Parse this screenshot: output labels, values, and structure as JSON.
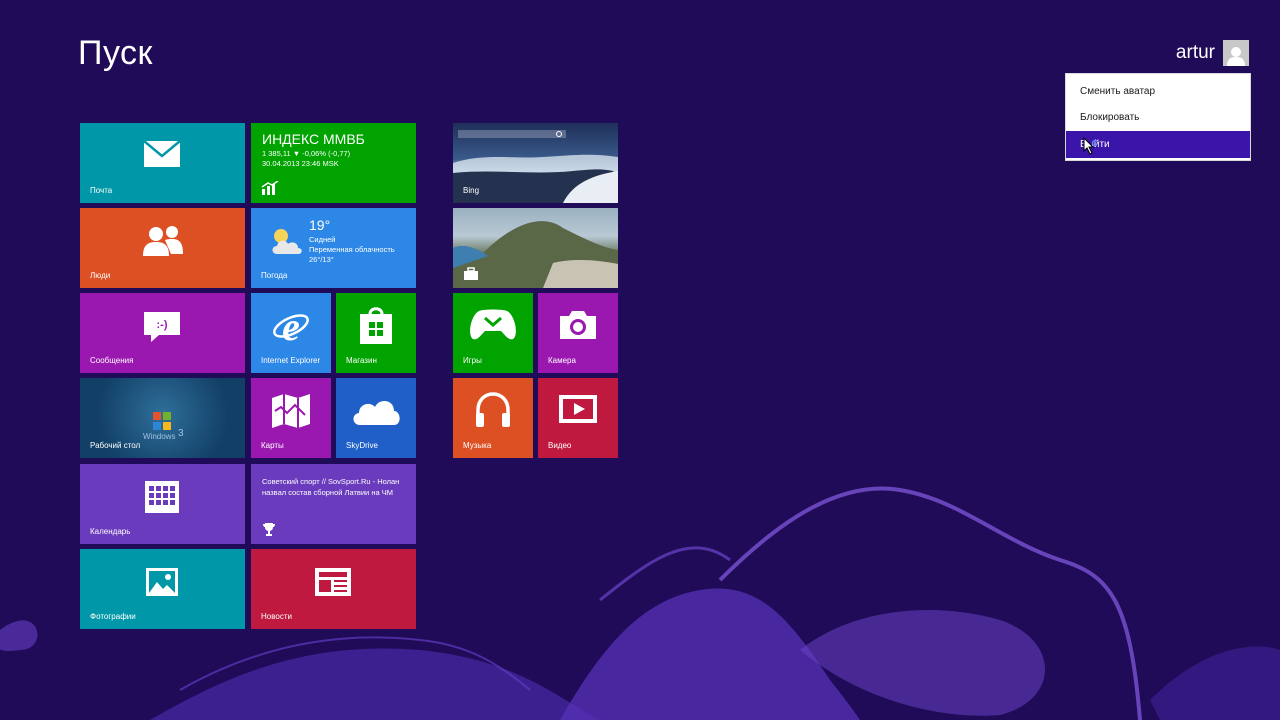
{
  "start": {
    "title": "Пуск",
    "user": "artur"
  },
  "user_menu": {
    "items": [
      "Сменить аватар",
      "Блокировать",
      "Выйти"
    ],
    "highlighted_index": 2
  },
  "colors": {
    "background": "#200b58",
    "menu_highlight": "#3b15a9",
    "teal": "#0098a8",
    "green": "#00a300",
    "orange": "#dc5024",
    "blue": "#2d87e6",
    "purple": "#9a18b0",
    "violet": "#6a3bbd",
    "red": "#c0193f"
  },
  "tiles": {
    "mail": {
      "label": "Почта",
      "icon": "mail-icon"
    },
    "finance": {
      "label": "ИНДЕКС ММВБ",
      "line1": "1 385,11  ▼  -0,06% (-0,77)",
      "line2": "30.04.2013 23:46 MSK",
      "icon": "chart-icon"
    },
    "people": {
      "label": "Люди",
      "icon": "people-icon"
    },
    "weather": {
      "label": "Погода",
      "temp": "19°",
      "city": "Сидней",
      "cond": "Переменная облачность",
      "range": "26°/13°",
      "icon": "cloud-sun-icon"
    },
    "messages": {
      "label": "Сообщения",
      "icon": "message-icon"
    },
    "ie": {
      "label": "Internet Explorer",
      "icon": "ie-icon"
    },
    "store": {
      "label": "Магазин",
      "icon": "store-icon"
    },
    "desktop": {
      "label": "Рабочий стол",
      "watermark": "Windows",
      "watermark_digit": "3",
      "icon": "windows-logo-icon"
    },
    "maps": {
      "label": "Карты",
      "icon": "map-icon"
    },
    "skydrive": {
      "label": "SkyDrive",
      "icon": "cloud-icon"
    },
    "calendar": {
      "label": "Календарь",
      "icon": "calendar-icon"
    },
    "sport": {
      "text": "Советский спорт // SovSport.Ru - Нолан назвал состав сборной Латвии на ЧМ",
      "icon": "trophy-icon"
    },
    "photos": {
      "label": "Фотографии",
      "icon": "photo-icon"
    },
    "news": {
      "label": "Новости",
      "icon": "newspaper-icon"
    },
    "bing": {
      "label": "Bing",
      "icon": "bing-image"
    },
    "travel": {
      "label": "",
      "icon": "suitcase-icon"
    },
    "games": {
      "label": "Игры",
      "icon": "gamepad-icon"
    },
    "camera": {
      "label": "Камера",
      "icon": "camera-icon"
    },
    "music": {
      "label": "Музыка",
      "icon": "headphones-icon"
    },
    "video": {
      "label": "Видео",
      "icon": "video-icon"
    }
  }
}
